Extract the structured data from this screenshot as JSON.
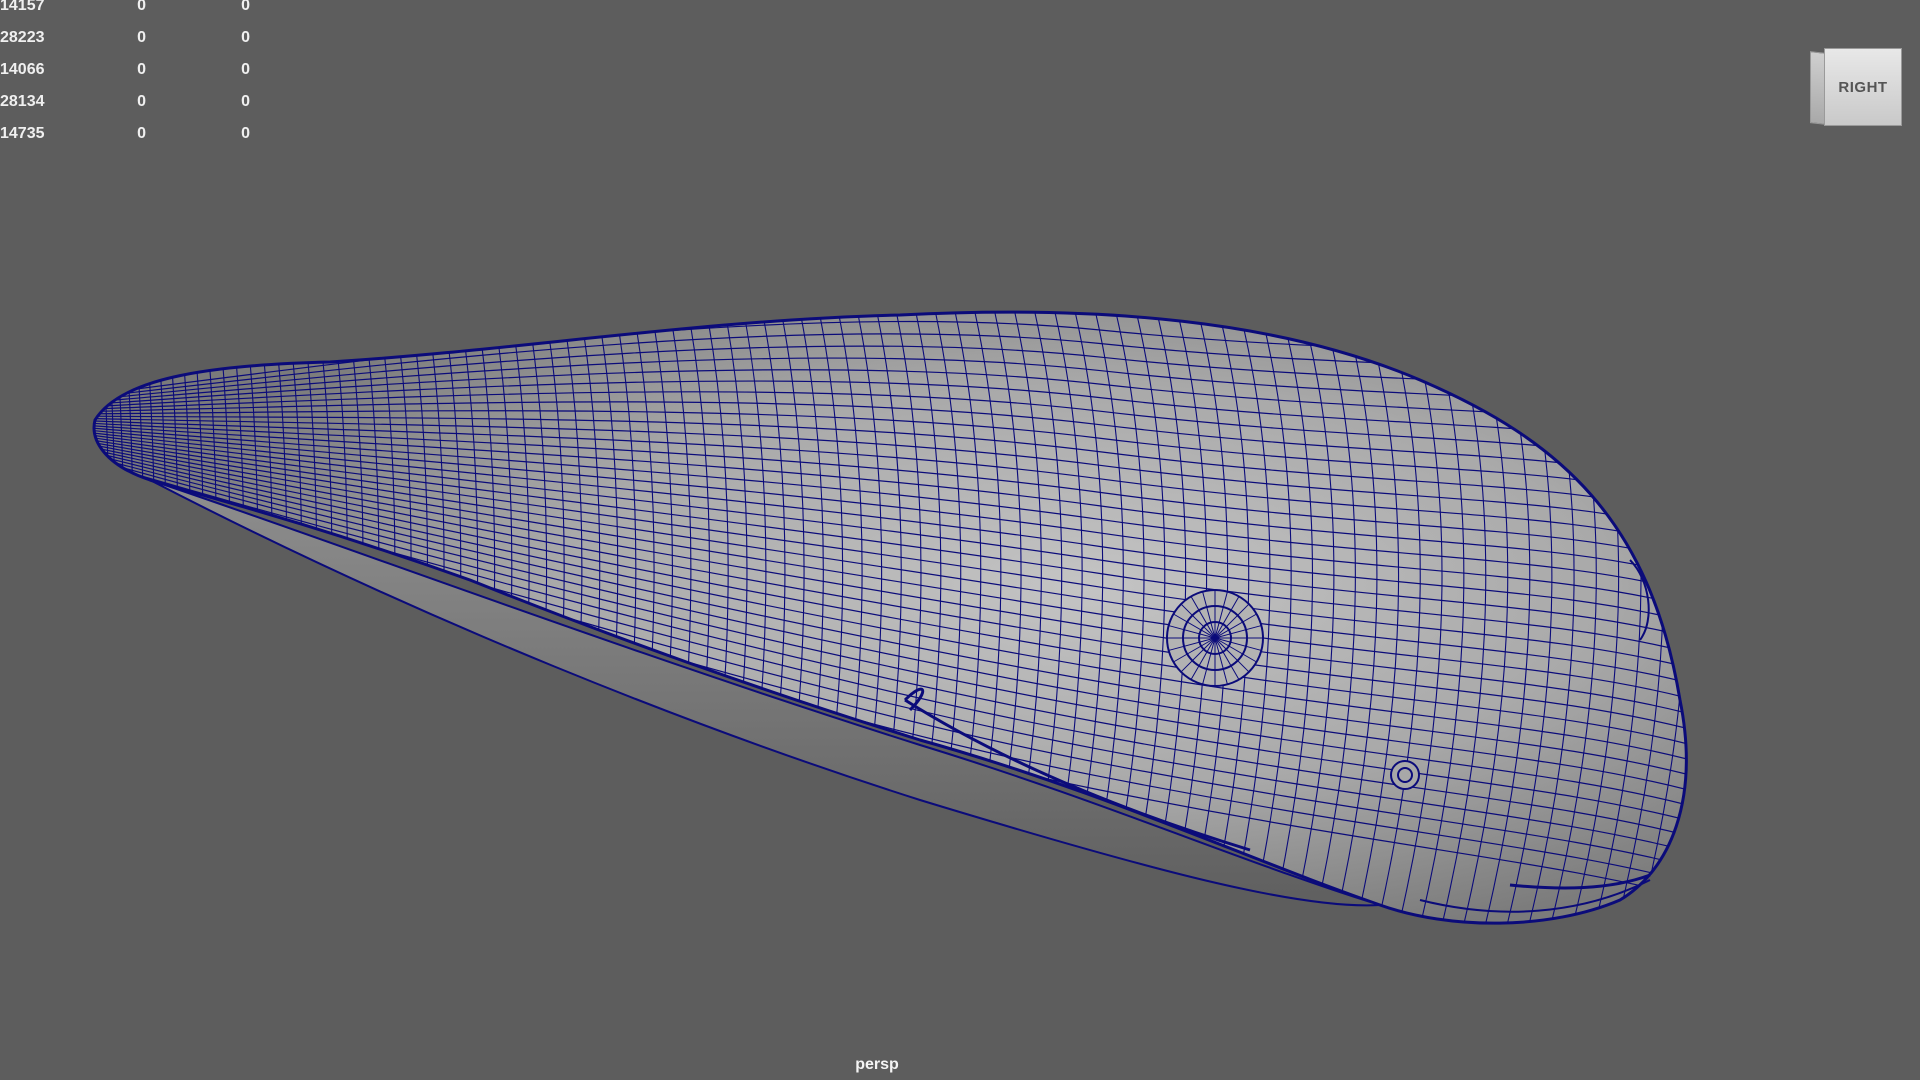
{
  "viewport": {
    "background": "#5d5d5d",
    "camera_label": "persp",
    "view_cube_label": "RIGHT",
    "mesh_color": "#bdbdbd",
    "wire_color": "#0b0b7a"
  },
  "hud": {
    "rows": [
      [
        "14157",
        "0",
        "0"
      ],
      [
        "28223",
        "0",
        "0"
      ],
      [
        "14066",
        "0",
        "0"
      ],
      [
        "28134",
        "0",
        "0"
      ],
      [
        "14735",
        "0",
        "0"
      ]
    ]
  },
  "model": {
    "description_icon": "fish-body-wireframe-mesh"
  }
}
